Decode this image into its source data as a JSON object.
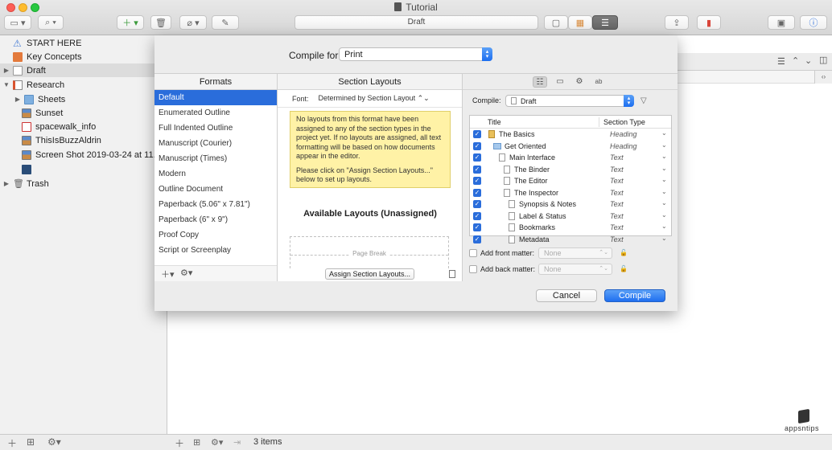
{
  "window": {
    "title": "Tutorial",
    "toolbar_center": "Draft"
  },
  "binder": {
    "items": [
      {
        "label": "START HERE",
        "icon": "warning-icon"
      },
      {
        "label": "Key Concepts",
        "icon": "key-icon"
      },
      {
        "label": "Draft",
        "icon": "document-icon"
      },
      {
        "label": "Research",
        "icon": "research-folder-icon"
      },
      {
        "label": "Sheets",
        "icon": "folder-icon"
      },
      {
        "label": "Sunset",
        "icon": "image-icon"
      },
      {
        "label": "spacewalk_info",
        "icon": "pdf-icon"
      },
      {
        "label": "ThisIsBuzzAldrin",
        "icon": "image-icon"
      },
      {
        "label": "Screen Shot 2019-03-24 at 11.57.3",
        "icon": "image-icon"
      },
      {
        "label": "",
        "icon": "film-icon"
      },
      {
        "label": "Trash",
        "icon": "trash-icon"
      }
    ]
  },
  "editor": {
    "status": "3 items"
  },
  "compile": {
    "compile_for_label": "Compile for:",
    "compile_for_value": "Print",
    "formats": {
      "header": "Formats",
      "items": [
        "Default",
        "Enumerated Outline",
        "Full Indented Outline",
        "Manuscript (Courier)",
        "Manuscript (Times)",
        "Modern",
        "Outline Document",
        "Paperback (5.06\" x 7.81\")",
        "Paperback (6\" x 9\")",
        "Proof Copy",
        "Script or Screenplay"
      ],
      "selected": "Default"
    },
    "layouts": {
      "header": "Section Layouts",
      "font_label": "Font:",
      "font_value": "Determined by Section Layout",
      "note_p1": "No layouts from this format have been assigned to any of the section types in the project yet. If no layouts are assigned, all text formatting will be based on how documents appear in the editor.",
      "note_p2": "Please click on \"Assign Section Layouts...\" below to set up layouts.",
      "available_title": "Available Layouts (Unassigned)",
      "page_break": "Page Break",
      "assign_button": "Assign Section Layouts..."
    },
    "contents": {
      "compile_label": "Compile:",
      "compile_value": "Draft",
      "col_title": "Title",
      "col_type": "Section Type",
      "rows": [
        {
          "title": "The Basics",
          "type": "Heading"
        },
        {
          "title": "Get Oriented",
          "type": "Heading"
        },
        {
          "title": "Main Interface",
          "type": "Text"
        },
        {
          "title": "The Binder",
          "type": "Text"
        },
        {
          "title": "The Editor",
          "type": "Text"
        },
        {
          "title": "The Inspector",
          "type": "Text"
        },
        {
          "title": "Synopsis & Notes",
          "type": "Text"
        },
        {
          "title": "Label & Status",
          "type": "Text"
        },
        {
          "title": "Bookmarks",
          "type": "Text"
        },
        {
          "title": "Metadata",
          "type": "Text"
        }
      ],
      "front_matter_label": "Add front matter:",
      "back_matter_label": "Add back matter:",
      "matter_placeholder": "None"
    },
    "cancel_button": "Cancel",
    "compile_button": "Compile"
  },
  "watermark": "appsntips",
  "colors": {
    "accent": "#2a6ddb",
    "note_bg": "#fff2a6"
  }
}
